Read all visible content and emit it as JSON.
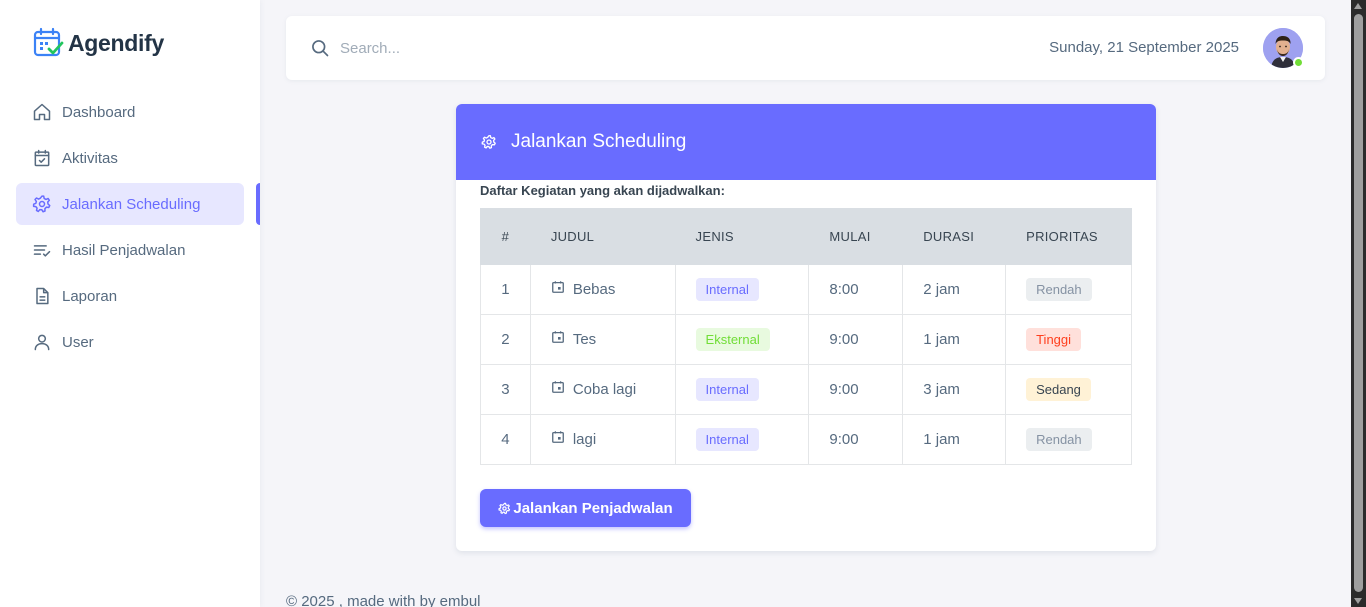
{
  "brand": {
    "name": "Agendify"
  },
  "sidebar": {
    "items": [
      {
        "label": "Dashboard",
        "icon": "home-icon"
      },
      {
        "label": "Aktivitas",
        "icon": "calendar-check-icon"
      },
      {
        "label": "Jalankan Scheduling",
        "icon": "gear-icon",
        "active": true
      },
      {
        "label": "Hasil Penjadwalan",
        "icon": "list-check-icon"
      },
      {
        "label": "Laporan",
        "icon": "file-icon"
      },
      {
        "label": "User",
        "icon": "user-icon"
      }
    ]
  },
  "navbar": {
    "search_placeholder": "Search...",
    "date": "Sunday, 21 September 2025",
    "avatar_status": "online"
  },
  "card": {
    "title": "Jalankan Scheduling",
    "subtitle": "Daftar Kegiatan yang akan dijadwalkan:",
    "columns": [
      "#",
      "JUDUL",
      "JENIS",
      "MULAI",
      "DURASI",
      "PRIORITAS"
    ],
    "rows": [
      {
        "no": "1",
        "judul": "Bebas",
        "jenis": "Internal",
        "mulai": "8:00",
        "durasi": "2 jam",
        "prioritas": "Rendah"
      },
      {
        "no": "2",
        "judul": "Tes",
        "jenis": "Eksternal",
        "mulai": "9:00",
        "durasi": "1 jam",
        "prioritas": "Tinggi"
      },
      {
        "no": "3",
        "judul": "Coba lagi",
        "jenis": "Internal",
        "mulai": "9:00",
        "durasi": "3 jam",
        "prioritas": "Sedang"
      },
      {
        "no": "4",
        "judul": "lagi",
        "jenis": "Internal",
        "mulai": "9:00",
        "durasi": "1 jam",
        "prioritas": "Rendah"
      }
    ],
    "button_label": "Jalankan Penjadwalan"
  },
  "footer": {
    "text": "© 2025 , made with by embul"
  },
  "colors": {
    "primary": "#696cff",
    "internal": "#696cff",
    "eksternal": "#71dd37",
    "tinggi": "#ff3e1d",
    "sedang": "#ffab00",
    "rendah": "#8592a3"
  }
}
